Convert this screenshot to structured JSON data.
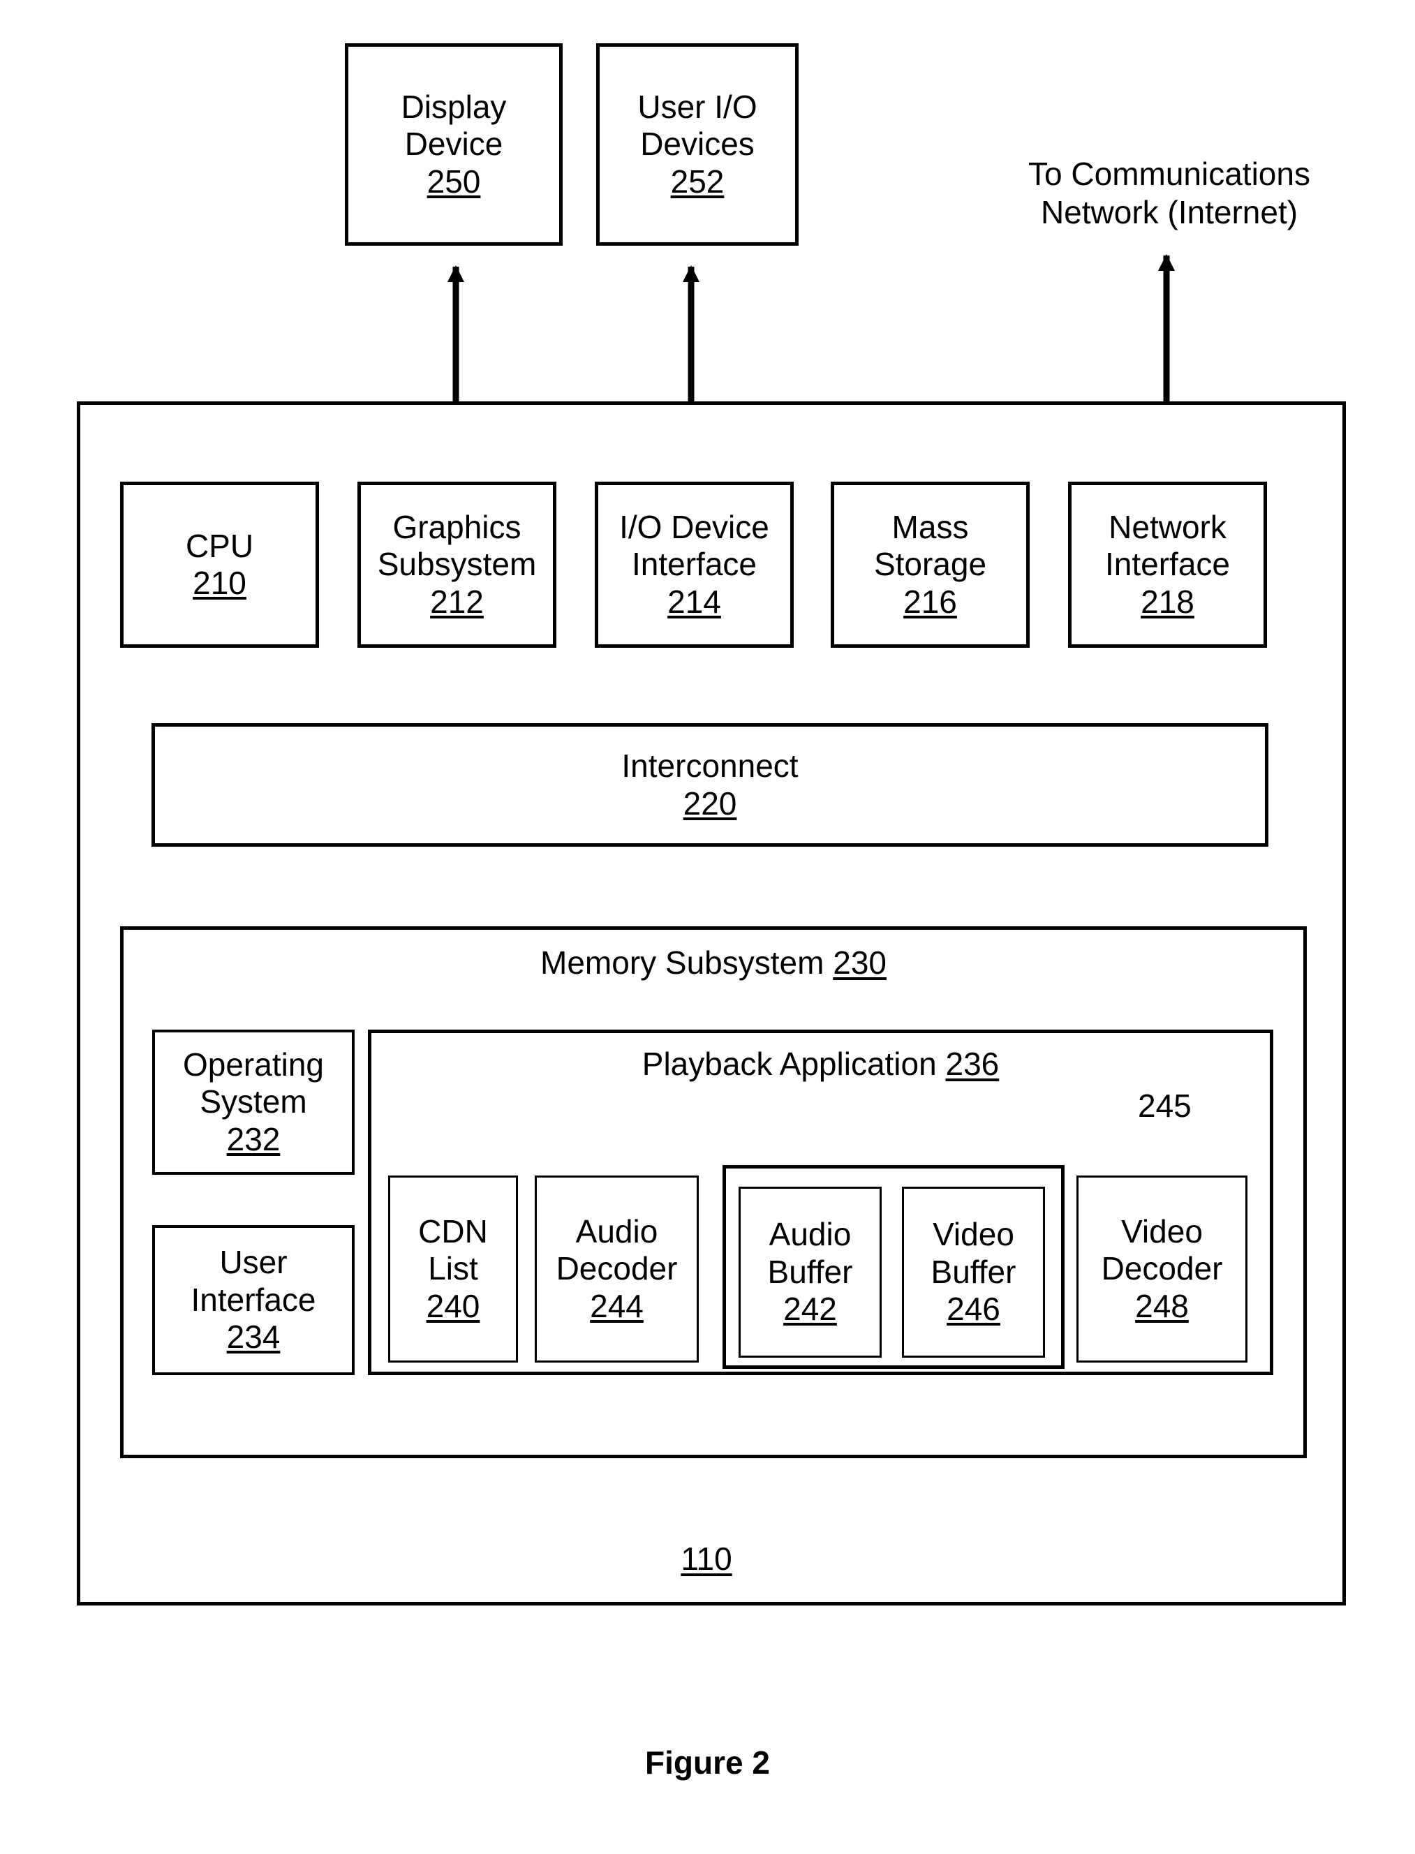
{
  "figure": {
    "caption": "Figure 2",
    "system_ref": "110"
  },
  "external": {
    "display_device": {
      "label_line1": "Display",
      "label_line2": "Device",
      "ref": "250"
    },
    "user_io_devices": {
      "label_line1": "User I/O",
      "label_line2": "Devices",
      "ref": "252"
    },
    "network_note": "To Communications\nNetwork (Internet)"
  },
  "components": [
    {
      "name": "cpu",
      "label_line1": "CPU",
      "label_line2": "",
      "ref": "210"
    },
    {
      "name": "graphics-subsystem",
      "label_line1": "Graphics",
      "label_line2": "Subsystem",
      "ref": "212"
    },
    {
      "name": "io-device-interface",
      "label_line1": "I/O Device",
      "label_line2": "Interface",
      "ref": "214"
    },
    {
      "name": "mass-storage",
      "label_line1": "Mass",
      "label_line2": "Storage",
      "ref": "216"
    },
    {
      "name": "network-interface",
      "label_line1": "Network",
      "label_line2": "Interface",
      "ref": "218"
    }
  ],
  "interconnect": {
    "label": "Interconnect",
    "ref": "220"
  },
  "memory_subsystem": {
    "title_label": "Memory Subsystem",
    "title_ref": "230",
    "operating_system": {
      "label_line1": "Operating",
      "label_line2": "System",
      "ref": "232"
    },
    "user_interface": {
      "label_line1": "User",
      "label_line2": "Interface",
      "ref": "234"
    },
    "playback_application": {
      "title_label": "Playback Application",
      "title_ref": "236",
      "buffer_group_ref": "245",
      "modules": [
        {
          "name": "cdn-list",
          "label_line1": "CDN",
          "label_line2": "List",
          "ref": "240"
        },
        {
          "name": "audio-decoder",
          "label_line1": "Audio",
          "label_line2": "Decoder",
          "ref": "244"
        },
        {
          "name": "audio-buffer",
          "label_line1": "Audio",
          "label_line2": "Buffer",
          "ref": "242"
        },
        {
          "name": "video-buffer",
          "label_line1": "Video",
          "label_line2": "Buffer",
          "ref": "246"
        },
        {
          "name": "video-decoder",
          "label_line1": "Video",
          "label_line2": "Decoder",
          "ref": "248"
        }
      ]
    }
  },
  "colors": {
    "stroke": "#000000",
    "background": "#ffffff"
  }
}
